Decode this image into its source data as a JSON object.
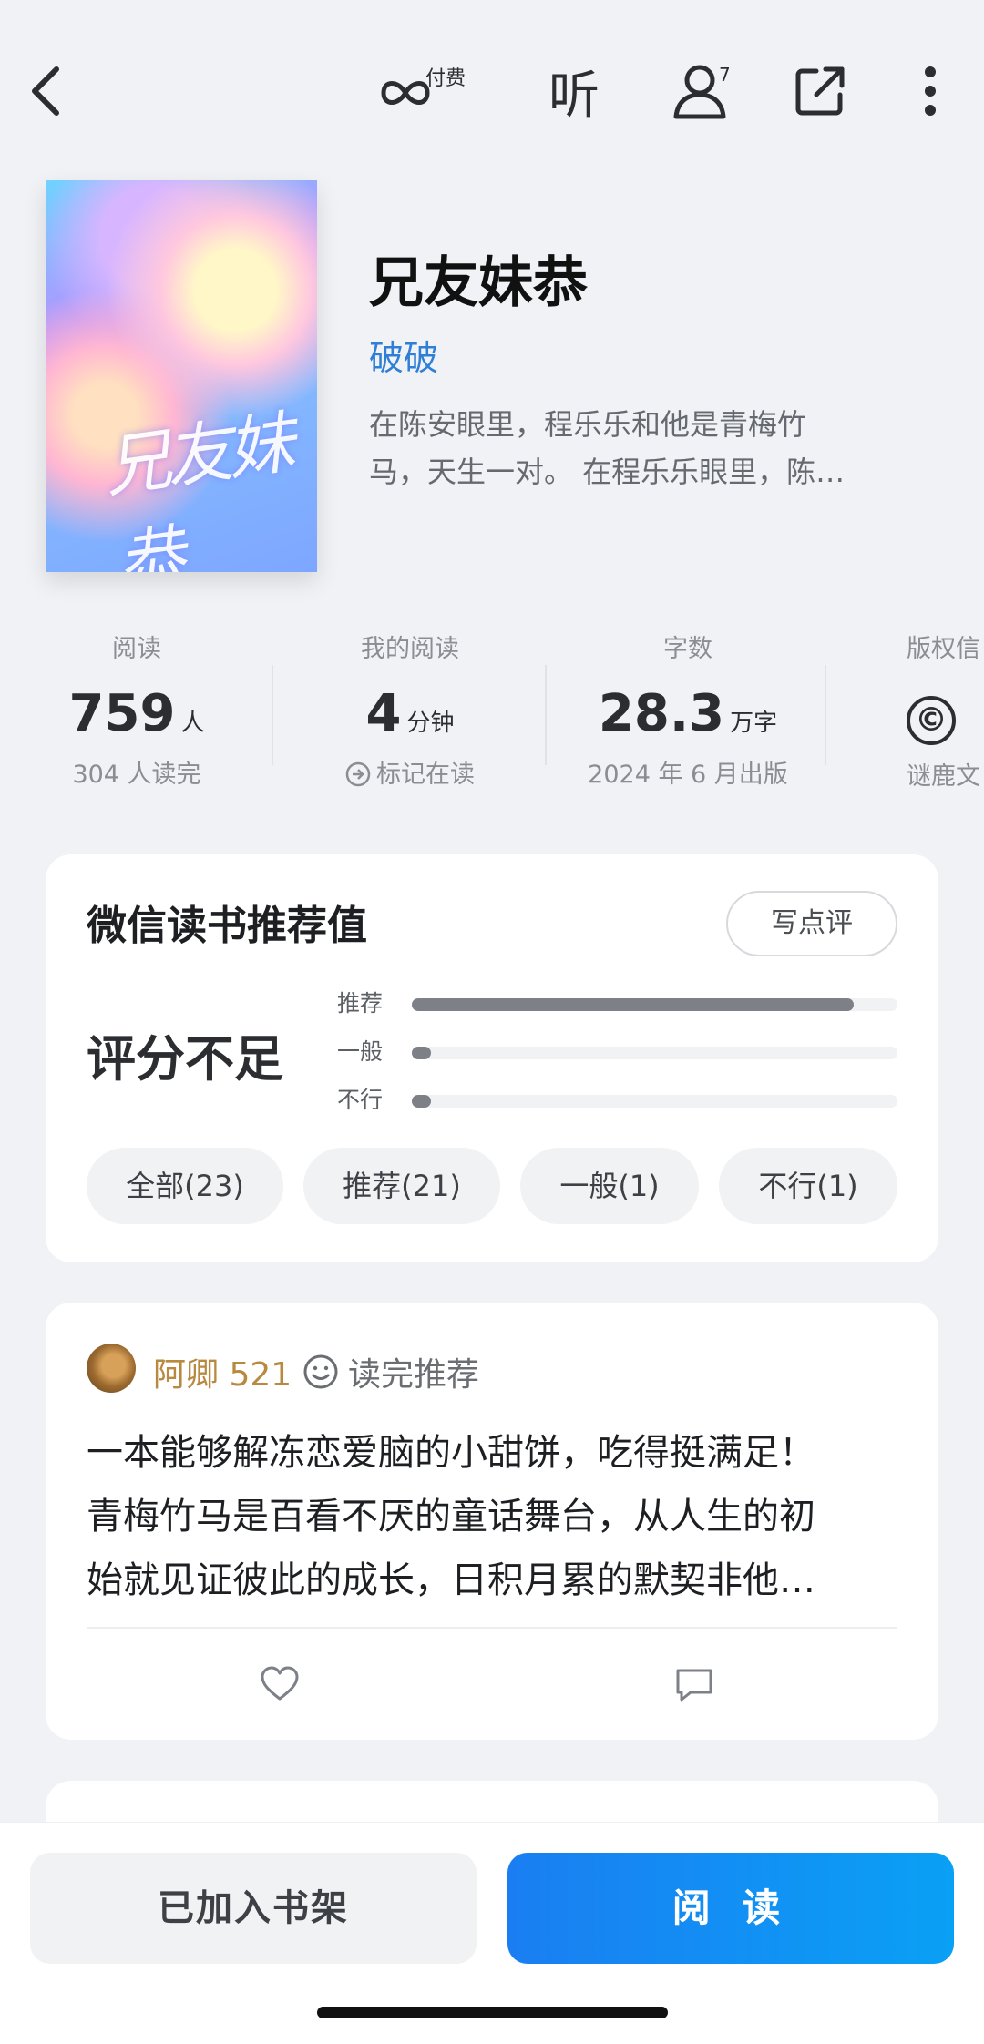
{
  "topbar": {
    "back_icon": "chevron-left-icon",
    "pay_label": "付费",
    "listen_label": "听",
    "friends_count": "7"
  },
  "book": {
    "cover_title": "兄友妹恭",
    "title": "兄友妹恭",
    "author": "破破",
    "description_line1": "在陈安眼里，程乐乐和他是青梅竹",
    "description_line2": "马，天生一对。 在程乐乐眼里，陈…"
  },
  "stats": [
    {
      "label": "阅读",
      "value": "759",
      "unit": "人",
      "sub": "304 人读完"
    },
    {
      "label": "我的阅读",
      "value": "4",
      "unit": "分钟",
      "sub": "标记在读"
    },
    {
      "label": "字数",
      "value": "28.3",
      "unit": "万字",
      "sub": "2024 年 6 月出版"
    },
    {
      "label": "版权信",
      "value": "©",
      "sub": "谜鹿文"
    }
  ],
  "recommend": {
    "title": "微信读书推荐值",
    "write_review": "写点评",
    "score_text": "评分不足",
    "bars": [
      {
        "label": "推荐",
        "fraction": 0.91
      },
      {
        "label": "一般",
        "fraction": 0.04
      },
      {
        "label": "不行",
        "fraction": 0.04
      }
    ],
    "filters": [
      "全部(23)",
      "推荐(21)",
      "一般(1)",
      "不行(1)"
    ]
  },
  "review": {
    "reviewer": "阿卿 521",
    "tag": "读完推荐",
    "line1": "一本能够解冻恋爱脑的小甜饼，吃得挺满足！",
    "line2": "青梅竹马是百看不厌的童话舞台，从人生的初",
    "line3": "始就见证彼此的成长，日积月累的默契非他…"
  },
  "actions": {
    "shelf": "已加入书架",
    "read": "阅 读"
  },
  "colors": {
    "accent_blue": "#1a7ef2",
    "author_blue": "#2f7fd6",
    "reviewer_gold": "#b8893f"
  }
}
